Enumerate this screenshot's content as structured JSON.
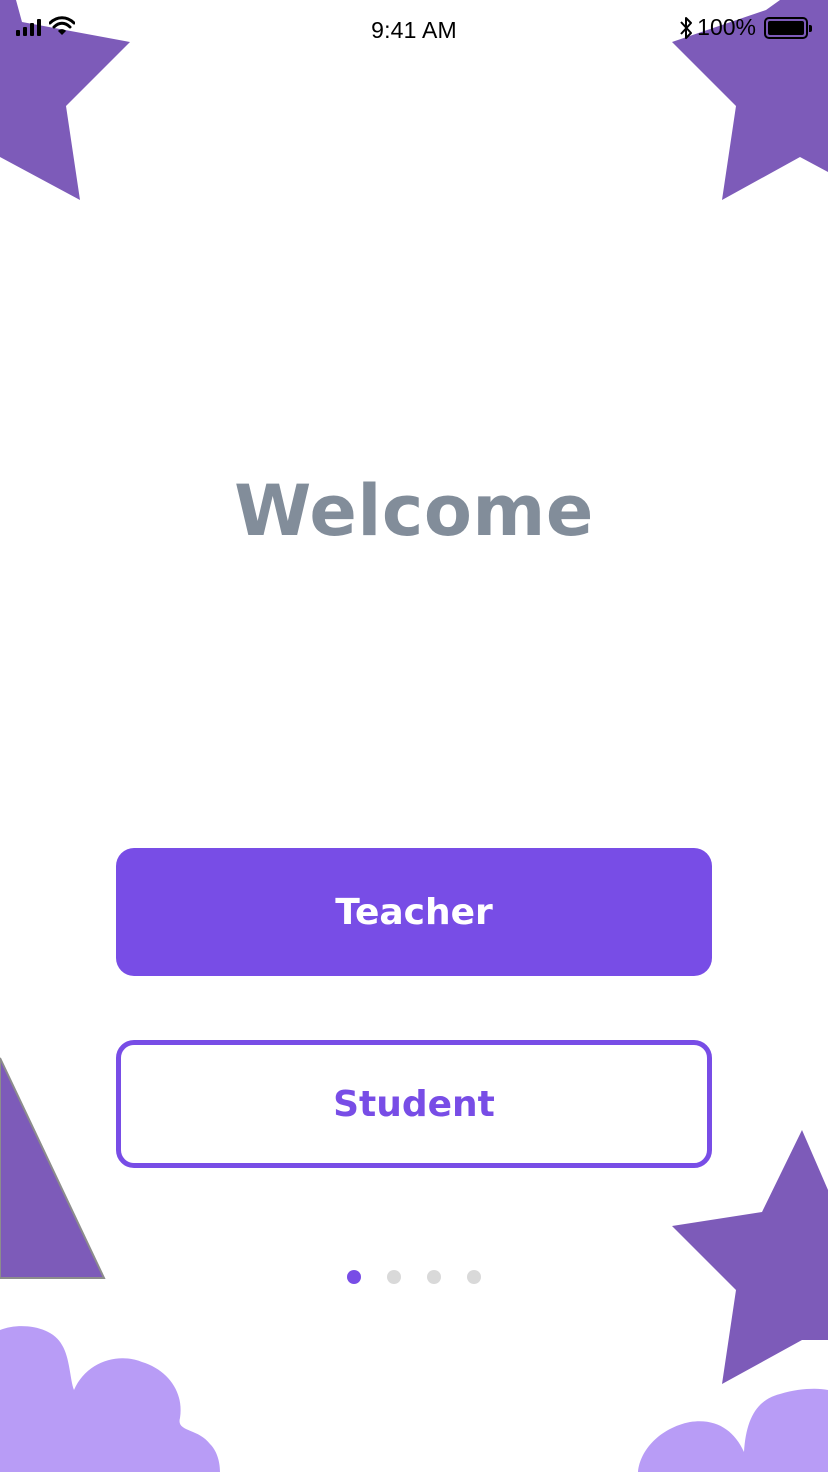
{
  "status_bar": {
    "time": "9:41 AM",
    "battery_percent": "100%",
    "icons": [
      "signal-icon",
      "wifi-icon",
      "bluetooth-icon",
      "battery-icon"
    ]
  },
  "welcome": {
    "title": "Welcome"
  },
  "actions": {
    "teacher_label": "Teacher",
    "student_label": "Student"
  },
  "pager": {
    "total_pages": 4,
    "current_page": 1
  },
  "colors": {
    "accent": "#784de6",
    "decor_purple": "#7d5bb9",
    "cloud_purple": "#b89cf6",
    "title_gray": "#828d9a",
    "dot_inactive": "#d9d9d9"
  }
}
